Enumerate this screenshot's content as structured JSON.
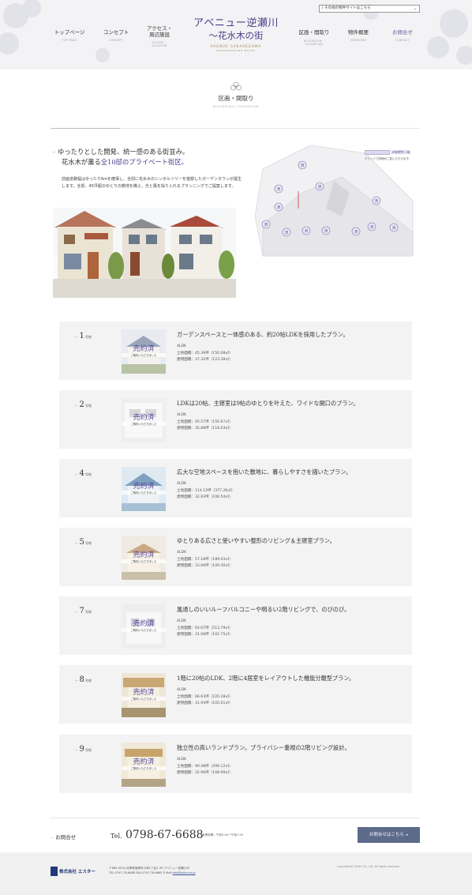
{
  "header": {
    "site_select": "[ その他の物件サイトはこちら",
    "nav": [
      {
        "jp": "トップページ",
        "en": "TOP PAGE"
      },
      {
        "jp": "コンセプト",
        "en": "CONCEPT"
      },
      {
        "jp1": "アクセス・",
        "jp2": "周辺施設",
        "en1": "ACCESS・",
        "en2": "LOCATION"
      },
      {
        "jp": "区画・間取り",
        "en1": "BLOCKPLAN・",
        "en2": "FLOORPLAN"
      },
      {
        "jp": "物件概要",
        "en": "OVERVIEW"
      },
      {
        "jp": "お問合せ",
        "en": "CONTACT"
      }
    ],
    "logo": {
      "line1": "アベニュー逆瀬川",
      "line2": "～花水木の街",
      "line3": "AVENUE SAKASEGAWA",
      "line4": "HANAMIZUKINO MACHI"
    }
  },
  "section": {
    "title_jp": "区画・間取り",
    "title_en": "BLOCKPLAN / FLOORPLAN"
  },
  "intro": {
    "lead1": "ゆったりとした開発、統一感のある街並み。",
    "lead2_pre": "花水木が薫る",
    "lead2_hl": "全10邸のプライベート街区。",
    "body": "前面道路幅はゆったり6mを確保し、全邸に花水木のシンボルツリーを植樹したガーデンタウンが誕生します。全邸、45坪超のゆとりの敷地を備え、光と風を採り入れるプランニングでご提案します。",
    "legend_label": "詳細閲覧可能",
    "legend_note": "クリックで詳細がご覧いただけます。",
    "map_sold_label": "済"
  },
  "plans": [
    {
      "no": "1",
      "suffix": "号地",
      "sold": "売約済",
      "sold_sub": "ご購約いただきました",
      "title": "ガーデンスペースと一体感のある、約20帖LDKを採用したプラン。",
      "layout": "4LDK",
      "land": "土地面積：45.39坪（150.08㎡）",
      "bldg": "建物面積：37.32坪（123.38㎡）"
    },
    {
      "no": "2",
      "suffix": "号地",
      "sold": "売約済",
      "sold_sub": "ご購約いただきました",
      "title": "LDKは20帖、主寝室は9帖のゆとりを叶えた、ワイドな開口のプラン。",
      "layout": "4LDK",
      "land": "土地面積：45.57坪（150.67㎡）",
      "bldg": "建物面積：35.88坪（118.63㎡）"
    },
    {
      "no": "4",
      "suffix": "号地",
      "sold": "売約済",
      "sold_sub": "ご購約いただきました",
      "title": "広大な空地スペースを抱いた敷地に、暮らしやすさを描いたプラン。",
      "layout": "4LDK",
      "land": "土地面積：114.12坪（377.26㎡）",
      "bldg": "建物面積：32.83坪（108.54㎡）"
    },
    {
      "no": "5",
      "suffix": "号地",
      "sold": "売約済",
      "sold_sub": "ご購約いただきました",
      "title": "ゆとりある広さと使いやすい整形のリビング＆主寝室プラン。",
      "layout": "4LDK",
      "land": "土地面積：57.18坪（189.03㎡）",
      "bldg": "建物面積：33.06坪（109.30㎡）"
    },
    {
      "no": "7",
      "suffix": "号地",
      "sold": "売約済",
      "sold_sub": "ご購約いただきました",
      "title": "風通しのいいルーフバルコニーや明るい2階リビングで、のびのび。",
      "layout": "4LDK",
      "land": "土地面積：64.67坪（213.79㎡）",
      "bldg": "建物面積：31.08坪（102.75㎡）"
    },
    {
      "no": "8",
      "suffix": "号地",
      "sold": "売約済",
      "sold_sub": "ご購約いただきました",
      "title": "1階に20帖のLDK、2階に4居室をレイアウトした機能分離型プラン。",
      "layout": "4LDK",
      "land": "土地面積：66.63坪（220.28㎡）",
      "bldg": "建物面積：31.94坪（105.61㎡）"
    },
    {
      "no": "9",
      "suffix": "号地",
      "sold": "売約済",
      "sold_sub": "ご購約いただきました",
      "title": "独立性の高いランドプラン。プライバシー重視の2階リビング設計。",
      "layout": "4LDK",
      "land": "土地面積：90.48坪（299.12㎡）",
      "bldg": "建物面積：32.96坪（108.99㎡）"
    }
  ],
  "contact": {
    "label": "お問合せ",
    "tel_prefix": "Tel.",
    "tel": "0798-67-6688",
    "hours": "営業時間：午前9:00～午後7:00",
    "cta": "お問合せはこちら",
    "cta_arrow": "▸"
  },
  "footer": {
    "company": "株式会社 エスター",
    "addr1": "〒665-0034 兵庫県宝塚市小林1丁目1-39 アベニュー逆瀬川3F",
    "addr2": "TEL.0797-78-6688 FAX.0797-78-6665 E-Mail:",
    "mail": "info@ester.co.jp",
    "copyright": "Copyright(C) Ester Co., Ltd. All rights reserved."
  },
  "colors": {
    "brand_purple": "#4b3d8a",
    "gold_accent": "#b89a5a",
    "cta_bg": "#5d6b8a",
    "plan_bg": "#f3f3f3"
  }
}
